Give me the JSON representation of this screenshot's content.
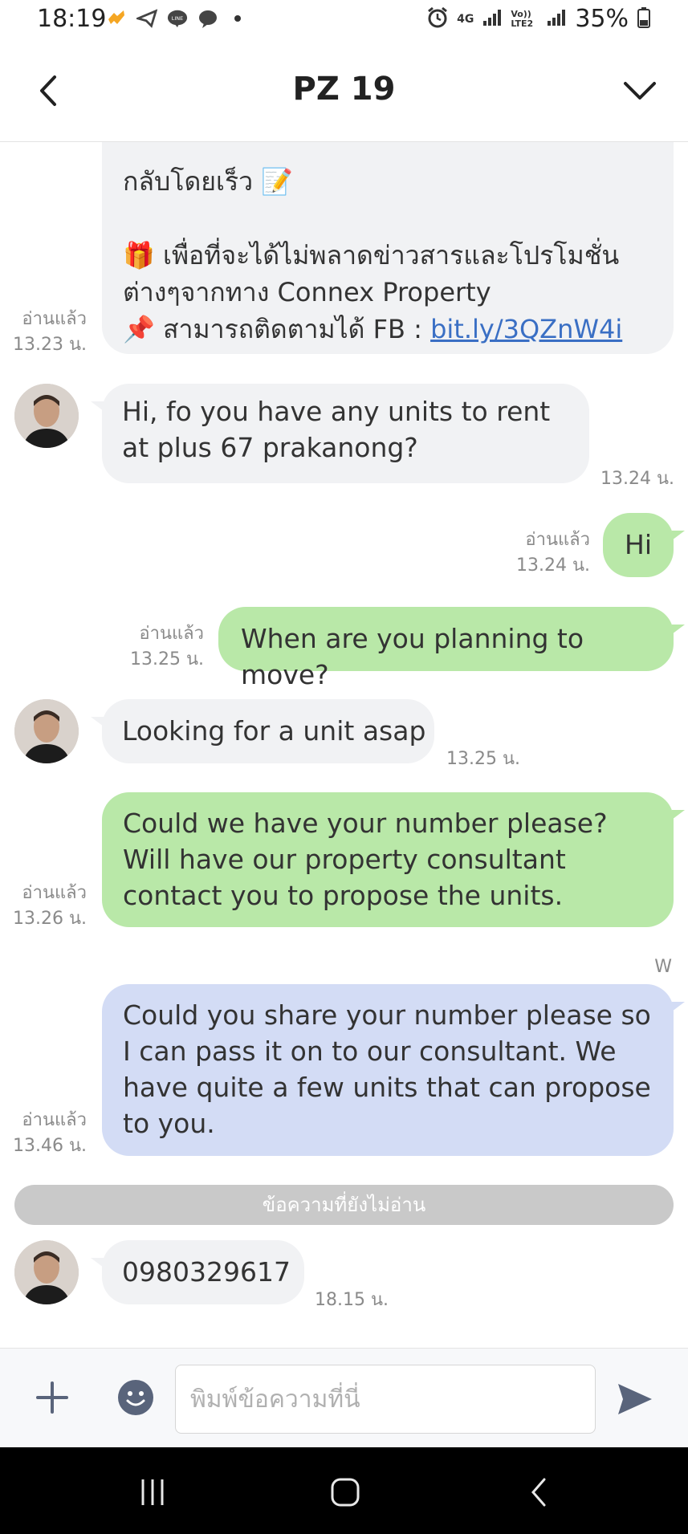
{
  "status_bar": {
    "time": "18:19",
    "network_4g": "4G",
    "volte": "Vo)) LTE2",
    "battery": "35%"
  },
  "header": {
    "title": "PZ 19"
  },
  "messages": {
    "m1": {
      "line1": "กลับโดยเร็ว 📝",
      "line2": "🎁 เพื่อที่จะได้ไม่พลาดข่าวสารและโปรโมชั่น",
      "line3": "ต่างๆจากทาง Connex Property",
      "line4_prefix": "📌 สามารถติดตามได้ FB : ",
      "link": "bit.ly/3QZnW4i",
      "read": "อ่านแล้ว",
      "time": "13.23 น."
    },
    "m2": {
      "text": "Hi, fo you have any units to rent at plus 67 prakanong?",
      "time": "13.24 น."
    },
    "m3": {
      "text": "Hi",
      "read": "อ่านแล้ว",
      "time": "13.24 น."
    },
    "m4": {
      "text": "When are you planning to move?",
      "read": "อ่านแล้ว",
      "time": "13.25 น."
    },
    "m5": {
      "text": "Looking for a unit asap",
      "time": "13.25 น."
    },
    "m6": {
      "text": "Could we have your number please? Will have our property consultant contact you to propose the units.",
      "read": "อ่านแล้ว",
      "time": "13.26 น."
    },
    "m7": {
      "sender": "W",
      "text": "Could you share your number please so I can pass it on to our consultant. We have quite a few units that can propose to you.",
      "read": "อ่านแล้ว",
      "time": "13.46 น."
    },
    "unread_divider": "ข้อความที่ยังไม่อ่าน",
    "m8": {
      "text": "0980329617",
      "time": "18.15 น."
    }
  },
  "input": {
    "placeholder": "พิมพ์ข้อความที่นี่"
  },
  "colors": {
    "incoming_bubble": "#f1f2f4",
    "outgoing_bubble": "#b9e8a8",
    "staff_bubble": "#d3dcf5",
    "link": "#3a6fc4"
  }
}
